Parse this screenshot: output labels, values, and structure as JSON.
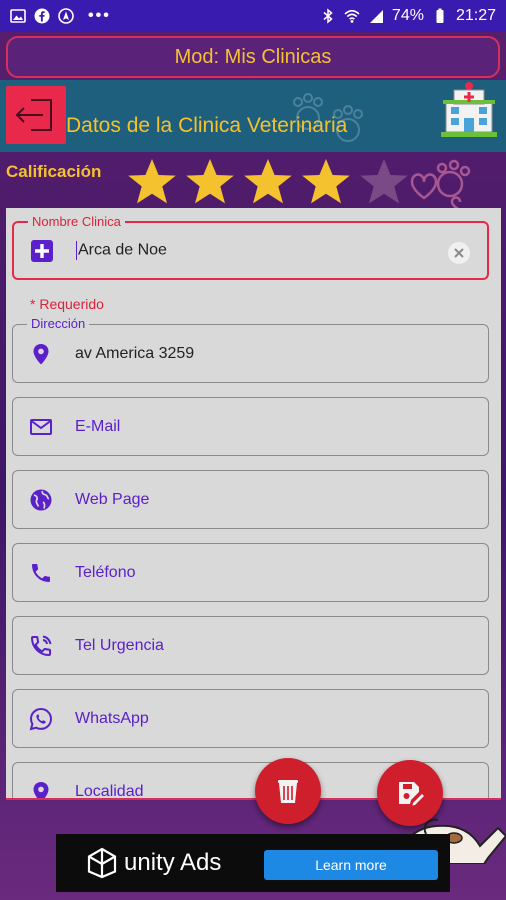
{
  "status_bar": {
    "battery": "74%",
    "time": "21:27",
    "left_icons": [
      "gallery-icon",
      "facebook-icon",
      "navigation-icon",
      "more-dots-icon"
    ],
    "right_icons": [
      "bluetooth-icon",
      "wifi-icon",
      "signal-icon",
      "battery-icon"
    ]
  },
  "topbar": {
    "title": "Mod: Mis Clinicas"
  },
  "header": {
    "title": "Datos de la Clinica Veterinaria"
  },
  "rating": {
    "label": "Calificación",
    "value": 4,
    "max": 5
  },
  "form": {
    "nombre": {
      "legend": "Nombre Clinica",
      "value": "Arca de Noe",
      "error": "* Requerido"
    },
    "direccion": {
      "legend": "Dirección",
      "value": "av America 3259"
    },
    "email": {
      "placeholder": "E-Mail"
    },
    "web": {
      "placeholder": "Web Page"
    },
    "telefono": {
      "placeholder": "Teléfono"
    },
    "tel_urgencia": {
      "placeholder": "Tel Urgencia"
    },
    "whatsapp": {
      "placeholder": "WhatsApp"
    },
    "localidad": {
      "placeholder": "Localidad"
    }
  },
  "ad": {
    "brand": "unity Ads",
    "cta": "Learn more"
  },
  "colors": {
    "status_bar": "#3a1bb0",
    "background": "#4a1a6e",
    "accent_yellow": "#f4c22e",
    "header_band": "#1e5f7e",
    "danger_red": "#e8294c",
    "icon_purple": "#5b20c9",
    "form_bg": "#d9d9d9",
    "fab_red": "#cf1f2d",
    "ad_button": "#1e88e5"
  }
}
